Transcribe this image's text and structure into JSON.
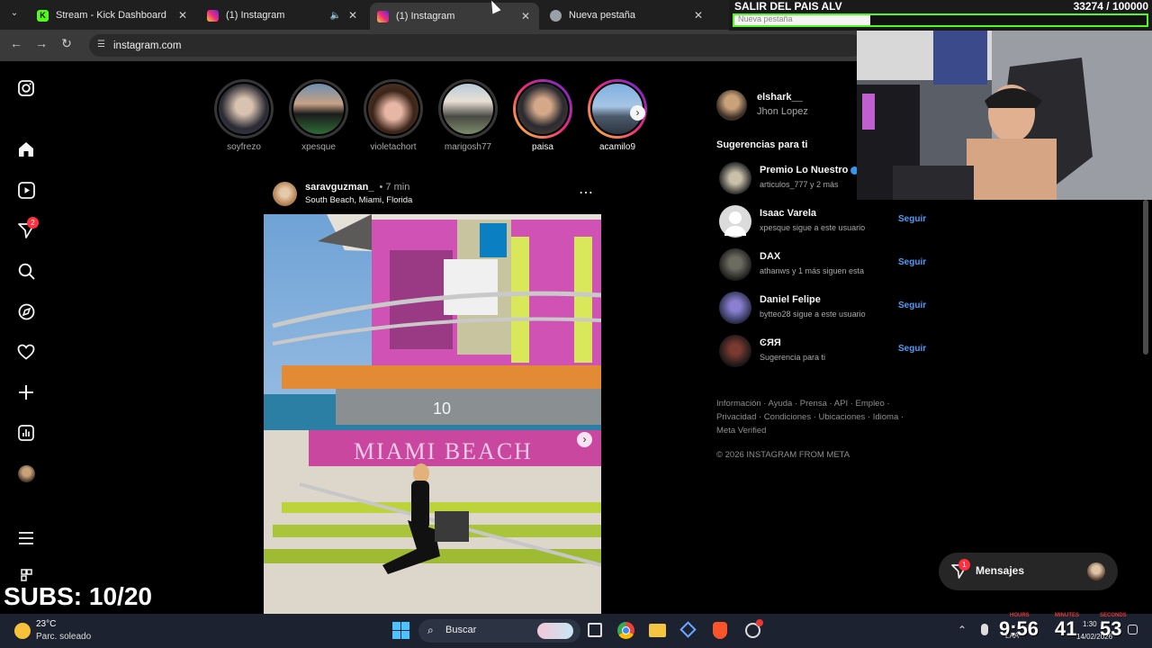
{
  "browser": {
    "tabs": [
      {
        "title": "Stream - Kick Dashboard",
        "color": "#53fc18"
      },
      {
        "title": "(1) Instagram",
        "color": "#e1306c"
      },
      {
        "title": "(1) Instagram",
        "color": "#e1306c"
      },
      {
        "title": "Nueva pestaña",
        "color": "#9aa0a6"
      }
    ],
    "url": "instagram.com"
  },
  "overlay": {
    "goal_title": "SALIR DEL PAIS ALV",
    "goal_count": "33274  /  100000",
    "goal_progress": 0.33,
    "goal_subtitle": "Nueva pestaña",
    "subs": "SUBS: 10/20"
  },
  "sidebar": {
    "notifications_badge": "2",
    "icons": [
      "instagram-icon",
      "home-icon",
      "reels-icon",
      "messages-icon",
      "search-icon",
      "explore-icon",
      "heart-icon",
      "create-icon",
      "dashboard-icon",
      "profile-icon",
      "menu-icon",
      "apps-icon"
    ]
  },
  "stories": [
    {
      "name": "soyfrezo",
      "seen": true
    },
    {
      "name": "xpesque",
      "seen": true
    },
    {
      "name": "violetachort",
      "seen": true
    },
    {
      "name": "marigosh77",
      "seen": true
    },
    {
      "name": "paisa",
      "seen": false
    },
    {
      "name": "acamilo9",
      "seen": false
    }
  ],
  "post": {
    "username": "saravguzman_",
    "time": "• 7 min",
    "location": "South Beach, Miami, Florida",
    "sign_number": "10",
    "sign_text": "MIAMI BEACH"
  },
  "profile": {
    "username": "elshark__",
    "fullname": "Jhon Lopez"
  },
  "suggestions": {
    "title": "Sugerencias para ti",
    "items": [
      {
        "name": "Premio Lo Nuestro",
        "sub": "articulos_777 y 2 más",
        "follow": ""
      },
      {
        "name": "Isaac Varela",
        "sub": "xpesque sigue a este usuario",
        "follow": "Seguir"
      },
      {
        "name": "DAX",
        "sub": "athanws y 1 más siguen esta",
        "follow": "Seguir"
      },
      {
        "name": "Daniel Felipe",
        "sub": "bytteo28 sigue a este usuario",
        "follow": "Seguir"
      },
      {
        "name": "ϾЯЯ",
        "sub": "Sugerencia para ti",
        "follow": "Seguir"
      }
    ]
  },
  "footer": {
    "links": "Información · Ayuda · Prensa · API · Empleo · Privacidad · Condiciones · Ubicaciones · Idioma · Meta Verified",
    "copyright": "© 2026 INSTAGRAM FROM META"
  },
  "messages": {
    "label": "Mensajes",
    "badge": "1"
  },
  "taskbar": {
    "weather_temp": "23°C",
    "weather_desc": "Parc. soleado",
    "search": "Buscar",
    "clock_time": "1:30",
    "clock_date": "14/02/2026",
    "lang": "LAA",
    "timer": {
      "hours": "9:56",
      "minutes": "41",
      "seconds": "53",
      "hours_label": "HOURS",
      "minutes_label": "MINUTES",
      "seconds_label": "SECONDS"
    }
  }
}
